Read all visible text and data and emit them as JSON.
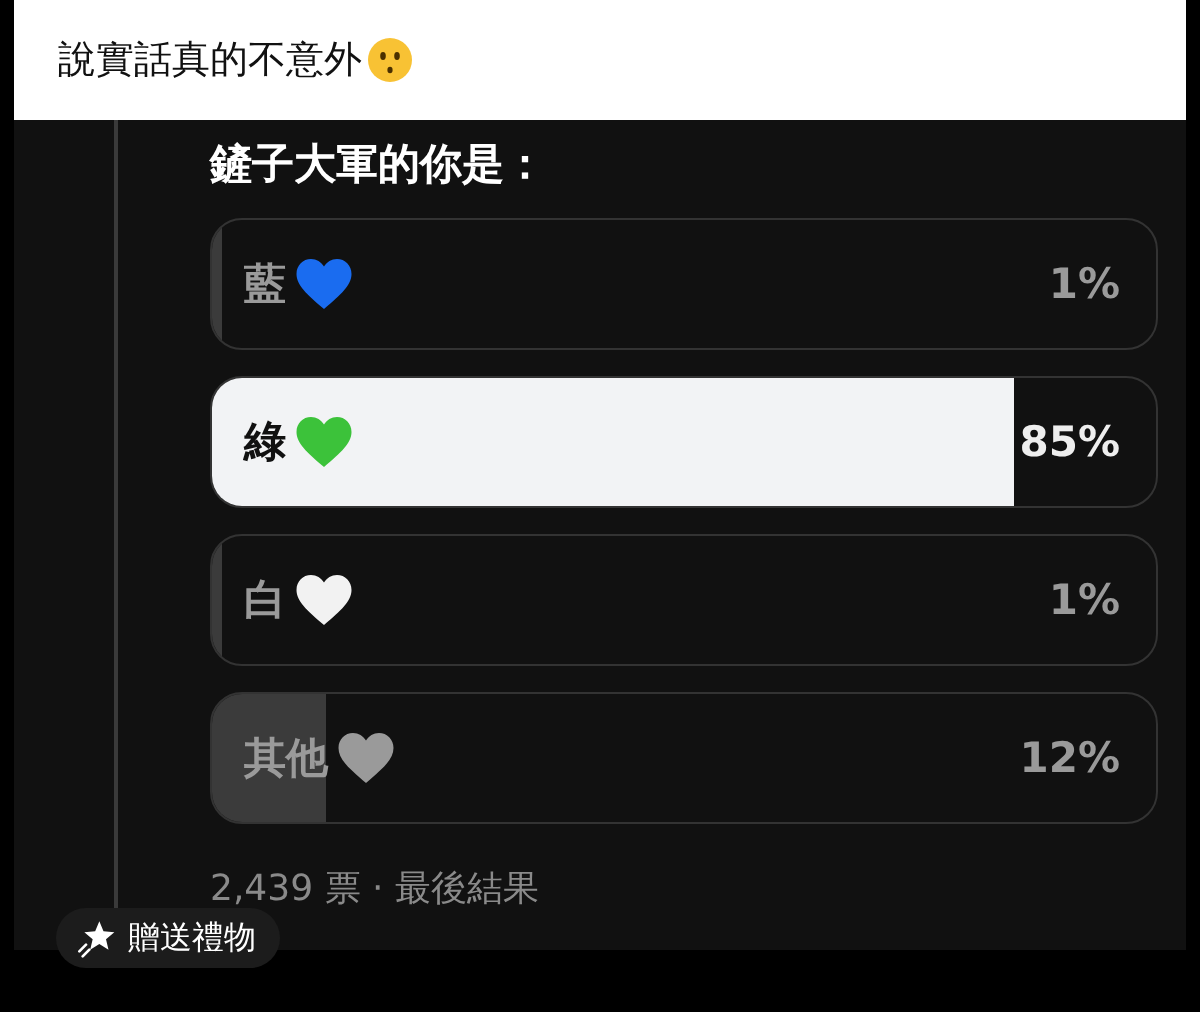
{
  "post": {
    "text": "說實話真的不意外"
  },
  "poll": {
    "question": "鏟子大軍的你是：",
    "options": [
      {
        "label": "藍",
        "color": "#1a6cf0",
        "percent": "1%",
        "level": 0.01,
        "selected": false
      },
      {
        "label": "綠",
        "color": "#3cc23a",
        "percent": "85%",
        "level": 0.85,
        "selected": true
      },
      {
        "label": "白",
        "color": "#f2f2f2",
        "percent": "1%",
        "level": 0.01,
        "selected": false
      },
      {
        "label": "其他",
        "color": "#9a9a9a",
        "percent": "12%",
        "level": 0.12,
        "selected": false
      }
    ],
    "footer": "2,439 票 · 最後結果"
  },
  "gift_button": {
    "label": "贈送禮物"
  }
}
